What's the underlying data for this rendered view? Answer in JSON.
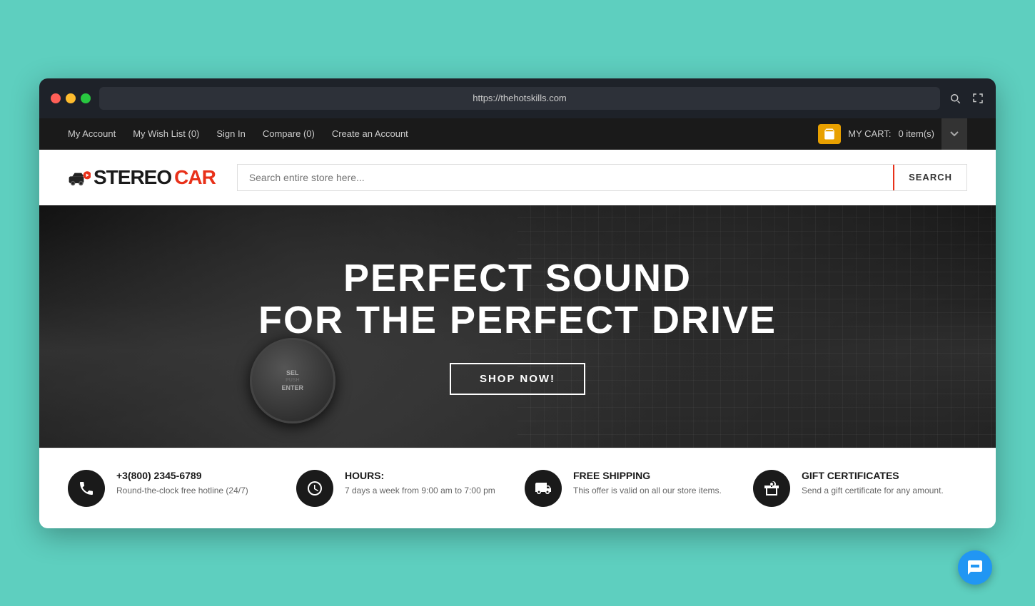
{
  "browser": {
    "url": "https://thehotskills.com",
    "search_icon": "🔍",
    "expand_icon": "⛶"
  },
  "topnav": {
    "links": [
      {
        "label": "My Account",
        "id": "my-account"
      },
      {
        "label": "My Wish List (0)",
        "id": "wishlist"
      },
      {
        "label": "Sign In",
        "id": "sign-in"
      },
      {
        "label": "Compare (0)",
        "id": "compare"
      },
      {
        "label": "Create an Account",
        "id": "create-account"
      }
    ],
    "cart_label": "MY CART:",
    "cart_count": "0 item(s)"
  },
  "header": {
    "logo_stereo": "STEREO",
    "logo_car": "CAR",
    "search_placeholder": "Search entire store here...",
    "search_button": "SEARCH"
  },
  "hero": {
    "title_line1": "PERFECT SOUND",
    "title_line2": "FOR THE PERFECT DRIVE",
    "cta_button": "SHOP NOW!"
  },
  "info_items": [
    {
      "icon": "phone",
      "heading": "+3(800) 2345-6789",
      "text": "Round-the-clock free hotline (24/7)"
    },
    {
      "icon": "clock",
      "heading": "HOURS:",
      "text": "7 days a week from 9:00 am to 7:00 pm"
    },
    {
      "icon": "truck",
      "heading": "FREE SHIPPING",
      "text": "This offer is valid on all our store items."
    },
    {
      "icon": "gift",
      "heading": "GIFT CERTIFICATES",
      "text": "Send a gift certificate for any amount."
    }
  ]
}
